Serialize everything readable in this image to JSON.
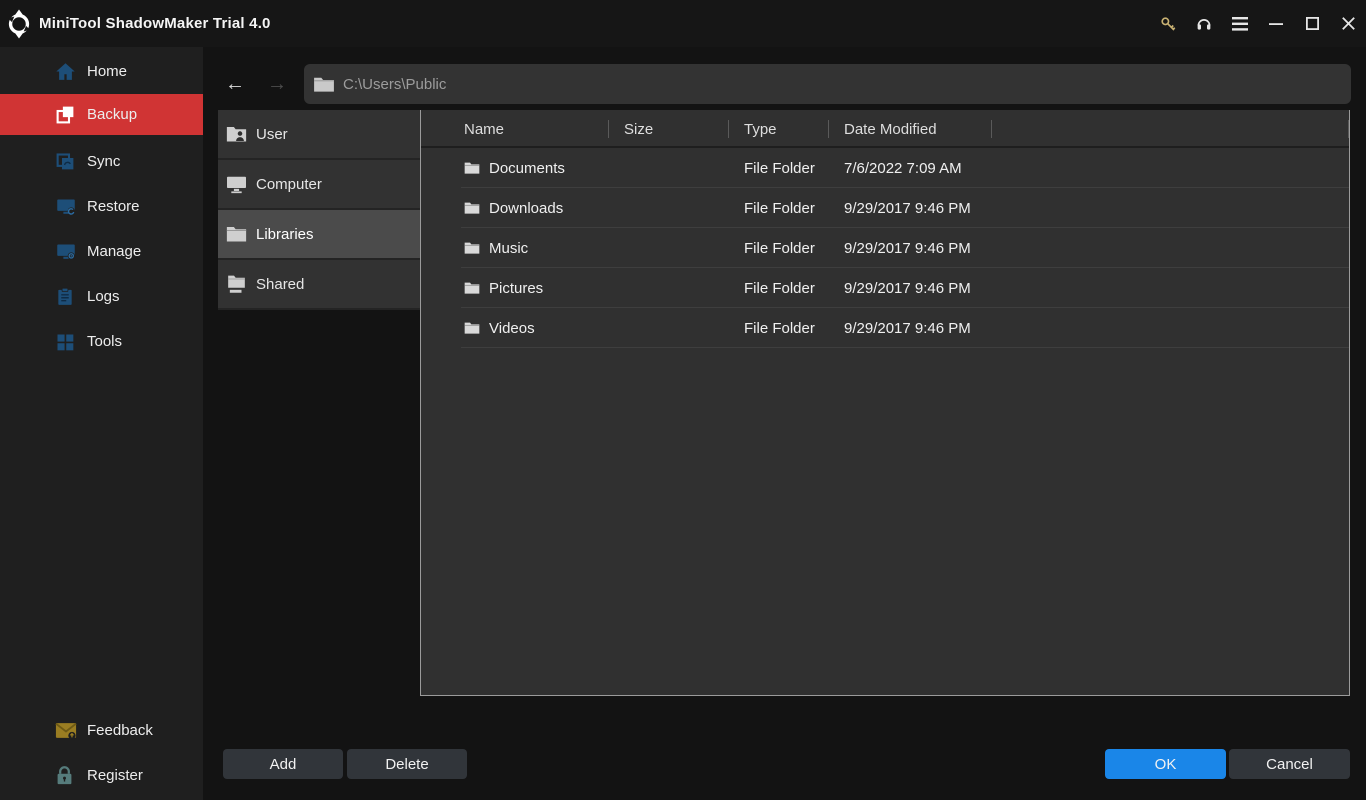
{
  "titlebar": {
    "title": "MiniTool ShadowMaker Trial 4.0",
    "icons": [
      "app-logo",
      "key-icon",
      "headset-icon",
      "menu-icon",
      "minimize-icon",
      "maximize-icon",
      "close-icon"
    ]
  },
  "sidebar": {
    "items": [
      {
        "label": "Home",
        "icon": "home-icon",
        "selected": false
      },
      {
        "label": "Backup",
        "icon": "backup-icon",
        "selected": true
      },
      {
        "label": "Sync",
        "icon": "sync-icon",
        "selected": false
      },
      {
        "label": "Restore",
        "icon": "restore-icon",
        "selected": false
      },
      {
        "label": "Manage",
        "icon": "manage-icon",
        "selected": false
      },
      {
        "label": "Logs",
        "icon": "logs-icon",
        "selected": false
      },
      {
        "label": "Tools",
        "icon": "tools-icon",
        "selected": false
      }
    ],
    "footer_items": [
      {
        "label": "Feedback",
        "icon": "feedback-icon"
      },
      {
        "label": "Register",
        "icon": "register-icon"
      }
    ]
  },
  "toolbar": {
    "back_glyph": "←",
    "forward_glyph": "→",
    "path": "C:\\Users\\Public"
  },
  "tree": {
    "items": [
      {
        "label": "User",
        "icon": "user-folder-icon",
        "selected": false
      },
      {
        "label": "Computer",
        "icon": "computer-icon",
        "selected": false
      },
      {
        "label": "Libraries",
        "icon": "folder-icon",
        "selected": true
      },
      {
        "label": "Shared",
        "icon": "shared-icon",
        "selected": false
      }
    ]
  },
  "file_list": {
    "columns": [
      "Name",
      "Size",
      "Type",
      "Date Modified"
    ],
    "rows": [
      {
        "name": "Documents",
        "size": "",
        "type": "File Folder",
        "date_modified": "7/6/2022 7:09 AM"
      },
      {
        "name": "Downloads",
        "size": "",
        "type": "File Folder",
        "date_modified": "9/29/2017 9:46 PM"
      },
      {
        "name": "Music",
        "size": "",
        "type": "File Folder",
        "date_modified": "9/29/2017 9:46 PM"
      },
      {
        "name": "Pictures",
        "size": "",
        "type": "File Folder",
        "date_modified": "9/29/2017 9:46 PM"
      },
      {
        "name": "Videos",
        "size": "",
        "type": "File Folder",
        "date_modified": "9/29/2017 9:46 PM"
      }
    ]
  },
  "footer": {
    "add_label": "Add",
    "delete_label": "Delete",
    "ok_label": "OK",
    "cancel_label": "Cancel"
  },
  "colors": {
    "accent_red": "#d03434",
    "accent_blue": "#1a86e8",
    "sidebar_icon_blue": "#1d4e78",
    "key_gold": "#c9b273",
    "feedback_gold": "#9a7d22",
    "register_teal": "#567c7c",
    "panel_border_gray": "#9b9b9b"
  }
}
